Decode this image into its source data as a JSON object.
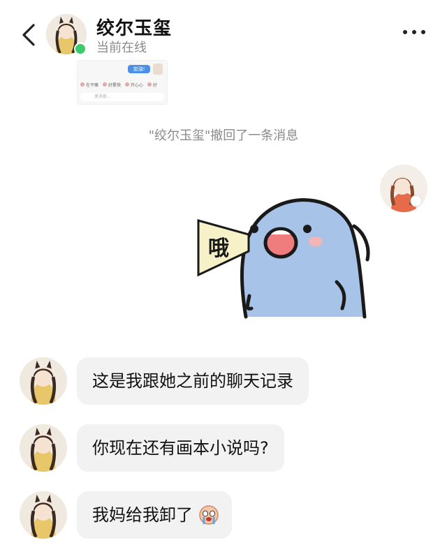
{
  "header": {
    "contact_name": "绞尔玉玺",
    "status": "当前在线"
  },
  "preview": {
    "bubble": "加油!",
    "reactions": [
      "在干嘛",
      "好累快",
      "开心心",
      "好"
    ],
    "input_placeholder": "发消息..."
  },
  "system": {
    "recall_notice": "\"绞尔玉玺\"撤回了一条消息"
  },
  "sticker": {
    "text": "哦"
  },
  "messages": [
    {
      "text": "这是我跟她之前的聊天记录"
    },
    {
      "text": "你现在还有画本小说吗?"
    },
    {
      "text": "我妈给我卸了"
    }
  ],
  "colors": {
    "online": "#3ccb6a",
    "bubble_bg": "#f2f2f2",
    "muted": "#8a8a8a",
    "sticker_body": "#a8c3e8"
  }
}
